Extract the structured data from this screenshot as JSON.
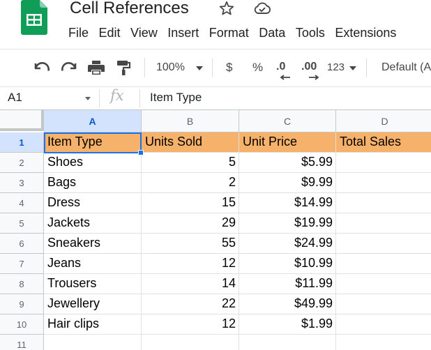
{
  "app": {
    "doc_title": "Cell References",
    "menu": [
      "File",
      "Edit",
      "View",
      "Insert",
      "Format",
      "Data",
      "Tools",
      "Extensions"
    ],
    "colors": {
      "header_fill": "#f6b26b",
      "selection": "#1a73e8",
      "sheets_green": "#0f9d58"
    }
  },
  "toolbar": {
    "zoom": "100%",
    "currency": "$",
    "percent": "%",
    "decrease_decimal": ".0",
    "increase_decimal": ".00",
    "more_formats": "123",
    "font": "Default (Arial)",
    "icons": [
      "undo-icon",
      "redo-icon",
      "print-icon",
      "paint-format-icon"
    ]
  },
  "formula_bar": {
    "cell_ref": "A1",
    "fx": "fx",
    "value": "Item Type"
  },
  "grid": {
    "columns": [
      "A",
      "B",
      "C",
      "D"
    ],
    "rows": [
      "1",
      "2",
      "3",
      "4",
      "5",
      "6",
      "7",
      "8",
      "9",
      "10",
      "11"
    ],
    "header": [
      "Item Type",
      "Units Sold",
      "Unit Price",
      "Total Sales"
    ],
    "data": [
      [
        "Shoes",
        "5",
        "$5.99",
        ""
      ],
      [
        "Bags",
        "2",
        "$9.99",
        ""
      ],
      [
        "Dress",
        "15",
        "$14.99",
        ""
      ],
      [
        "Jackets",
        "29",
        "$19.99",
        ""
      ],
      [
        "Sneakers",
        "55",
        "$24.99",
        ""
      ],
      [
        "Jeans",
        "12",
        "$10.99",
        ""
      ],
      [
        "Trousers",
        "14",
        "$11.99",
        ""
      ],
      [
        "Jewellery",
        "22",
        "$49.99",
        ""
      ],
      [
        "Hair clips",
        "12",
        "$1.99",
        ""
      ]
    ]
  }
}
